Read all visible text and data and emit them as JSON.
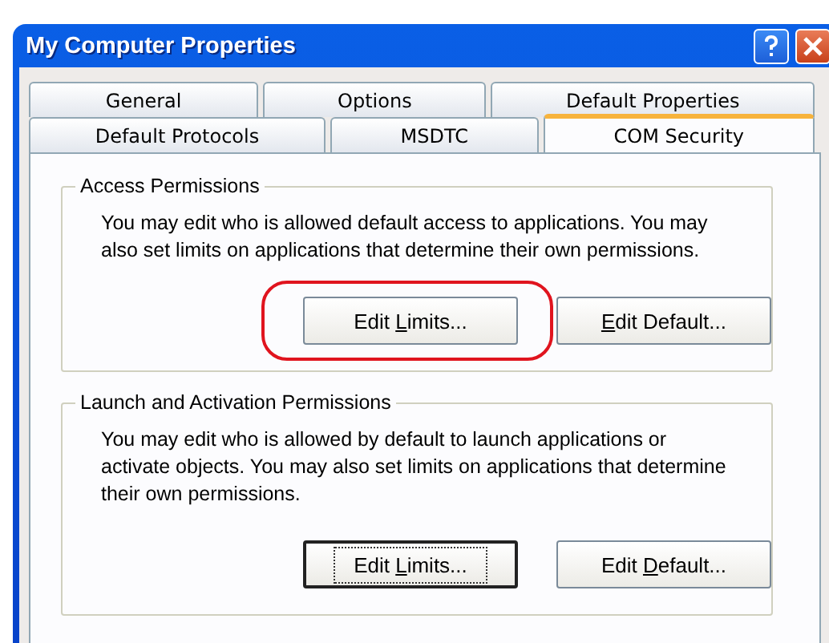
{
  "window": {
    "title": "My Computer Properties"
  },
  "tab_rows": [
    [
      {
        "label": "General",
        "selected": false
      },
      {
        "label": "Options",
        "selected": false
      },
      {
        "label": "Default Properties",
        "selected": false
      }
    ],
    [
      {
        "label": "Default Protocols",
        "selected": false
      },
      {
        "label": "MSDTC",
        "selected": false
      },
      {
        "label": "COM Security",
        "selected": true
      }
    ]
  ],
  "groups": [
    {
      "title": "Access Permissions",
      "text": "You may edit who is allowed default access to applications. You may also set limits on applications that determine their own permissions.",
      "buttons": [
        {
          "label": {
            "before": "Edit ",
            "key": "L",
            "after": "imits..."
          },
          "focused": false,
          "circled": true
        },
        {
          "label": {
            "key": "E",
            "after": "dit Default..."
          },
          "focused": false,
          "circled": false
        }
      ]
    },
    {
      "title": "Launch and Activation Permissions",
      "text": "You may edit who is allowed by default to launch applications or activate objects. You may also set limits on applications that determine their own permissions.",
      "buttons": [
        {
          "label": {
            "before": "Edit ",
            "key": "L",
            "after": "imits..."
          },
          "focused": true,
          "circled": false
        },
        {
          "label": {
            "before": "Edit ",
            "key": "D",
            "after": "efault..."
          },
          "focused": false,
          "circled": false
        }
      ]
    }
  ]
}
